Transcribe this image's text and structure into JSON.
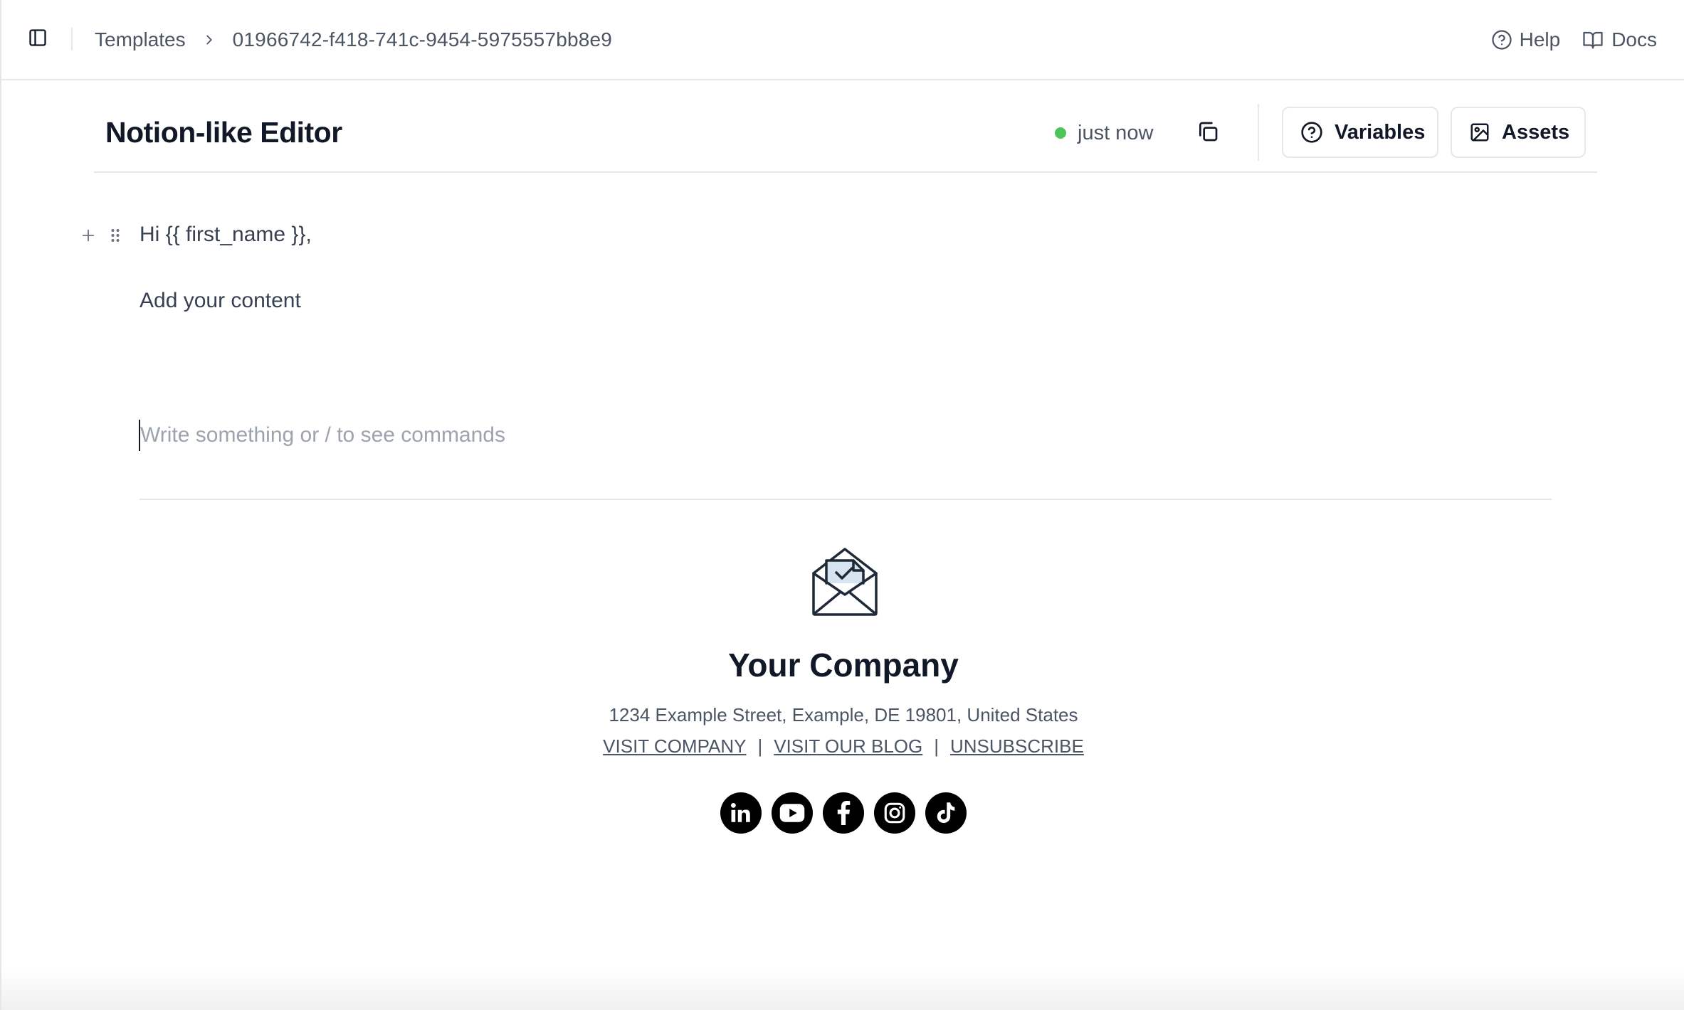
{
  "topbar": {
    "breadcrumb": {
      "parent": "Templates",
      "current": "01966742-f418-741c-9454-5975557bb8e9"
    },
    "help_label": "Help",
    "docs_label": "Docs"
  },
  "editor": {
    "title": "Notion-like Editor",
    "save_status": "just now",
    "status_color": "#4ec45a",
    "variables_label": "Variables",
    "assets_label": "Assets",
    "greeting": "Hi {{ first_name }},",
    "content": "Add your content",
    "input_placeholder": "Write something or / to see commands",
    "input_value": ""
  },
  "footer": {
    "logo_icon": "envelope-check-icon",
    "company_name": "Your Company",
    "address": "1234 Example Street, Example, DE 19801, United States",
    "links": {
      "visit_company": "VISIT COMPANY",
      "visit_blog": "VISIT OUR BLOG",
      "unsubscribe": "UNSUBSCRIBE",
      "separator": "|"
    },
    "social": [
      "linkedin",
      "youtube",
      "facebook",
      "instagram",
      "tiktok"
    ]
  }
}
